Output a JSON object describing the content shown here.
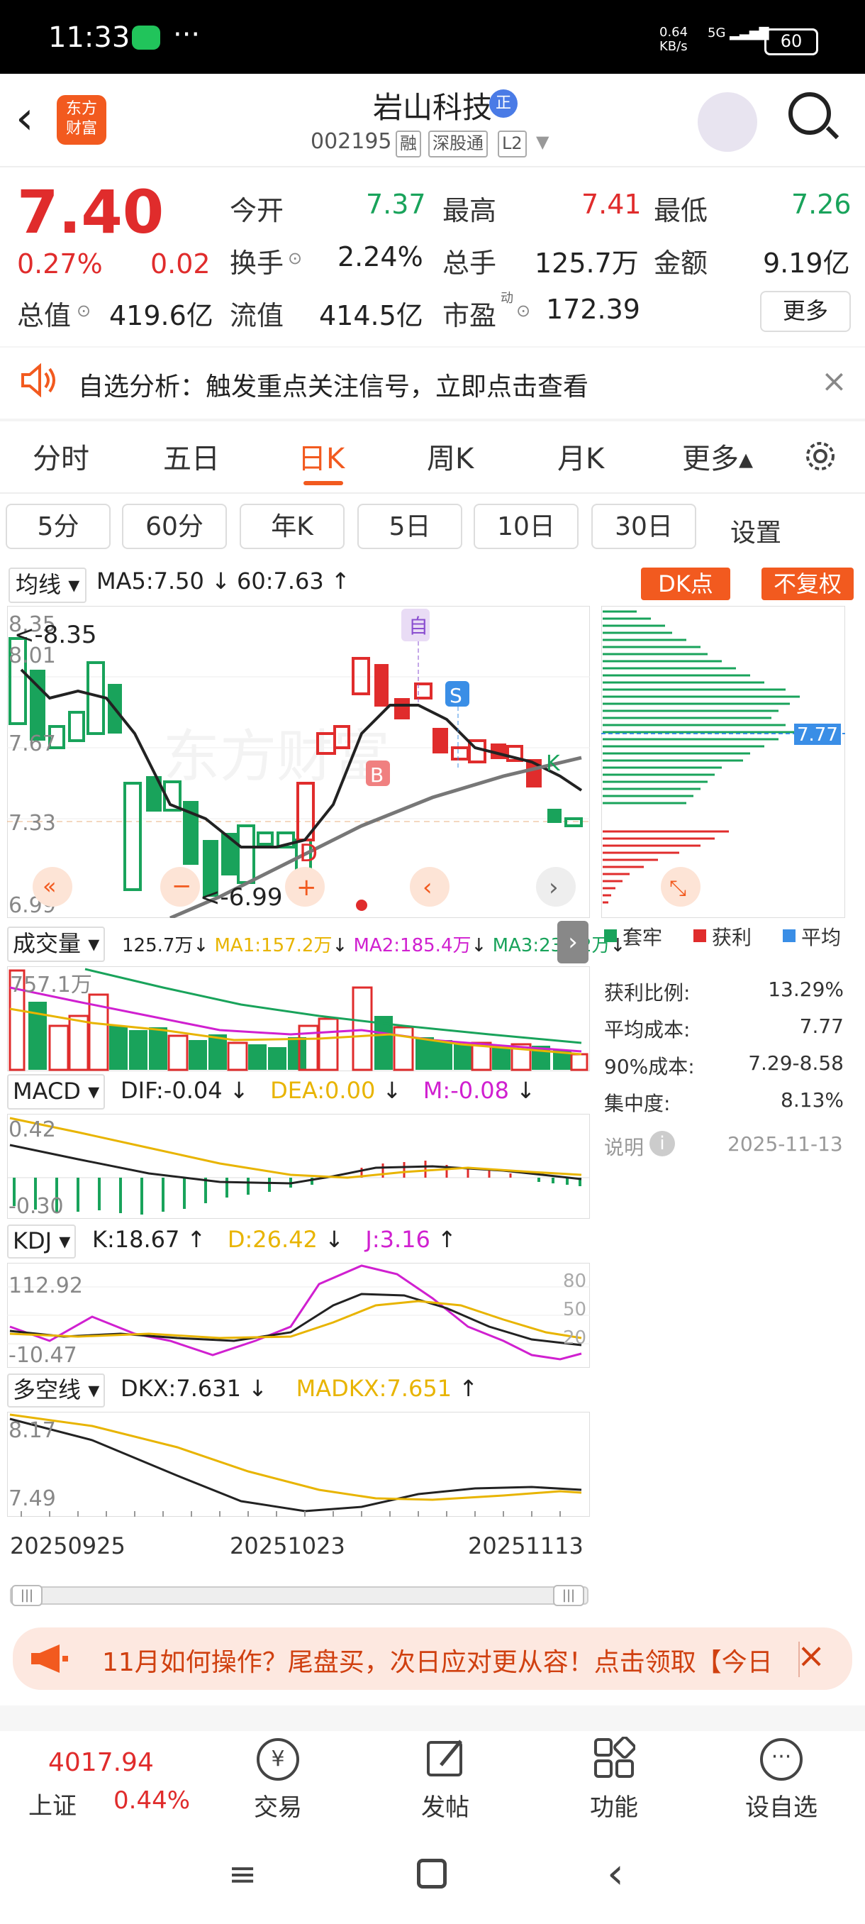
{
  "status_bar": {
    "time": "11:33",
    "net_speed": "0.64\nKB/s",
    "signal": "5G",
    "battery": "60",
    "more": "···"
  },
  "header": {
    "app_logo": "东方\n财富",
    "stock_name": "岩山科技",
    "stock_badge": "正",
    "stock_code": "002195",
    "tags": [
      "融",
      "深股通",
      "L2"
    ]
  },
  "quote": {
    "price": "7.40",
    "change_pct": "0.27%",
    "change": "0.02",
    "open_label": "今开",
    "open": "7.37",
    "high_label": "最高",
    "high": "7.41",
    "low_label": "最低",
    "low": "7.26",
    "turnover_label": "换手",
    "turnover": "2.24%",
    "volume_label": "总手",
    "volume": "125.7万",
    "amount_label": "金额",
    "amount": "9.19亿",
    "mktcap_label": "总值",
    "mktcap": "419.6亿",
    "float_label": "流值",
    "float": "414.5亿",
    "pe_label": "市盈",
    "pe_sup": "动",
    "pe": "172.39",
    "more_button": "更多"
  },
  "alert": {
    "text": "自选分析：触发重点关注信号，立即点击查看"
  },
  "tabs": [
    "分时",
    "五日",
    "日K",
    "周K",
    "月K",
    "更多▴"
  ],
  "active_tab": "日K",
  "periods": [
    "5分",
    "60分",
    "年K",
    "5日",
    "10日",
    "30日"
  ],
  "periods_setting": "设置",
  "ma_bar": {
    "selector": "均线",
    "ma5": "MA5:7.50",
    "ma60": "60:7.63",
    "dk_button": "DK点",
    "fq_button": "不复权"
  },
  "kline": {
    "y_labels": [
      "8.35",
      "8.01",
      "7.67",
      "7.33",
      "6.99"
    ],
    "high_marker": "<-8.35",
    "low_marker": "<-6.99",
    "markers": [
      "自",
      "S",
      "B",
      "D",
      "K"
    ],
    "watermark": "东方财富"
  },
  "chip": {
    "avg_label": "7.77",
    "legend": [
      "套牢",
      "获利",
      "平均"
    ],
    "stats": [
      {
        "label": "获利比例:",
        "value": "13.29%"
      },
      {
        "label": "平均成本:",
        "value": "7.77"
      },
      {
        "label": "90%成本:",
        "value": "7.29-8.58"
      },
      {
        "label": "集中度:",
        "value": "8.13%"
      }
    ],
    "note_label": "说明",
    "date": "2025-11-13"
  },
  "volume": {
    "selector": "成交量",
    "vol": "125.7万",
    "ma1": "MA1:157.2万",
    "ma2": "MA2:185.4万",
    "ma3": "MA3:239.2万",
    "y_label": "757.1万"
  },
  "macd": {
    "selector": "MACD",
    "dif": "DIF:-0.04",
    "dea": "DEA:0.00",
    "m": "M:-0.08",
    "y_top": "0.42",
    "y_bottom": "-0.30"
  },
  "kdj": {
    "selector": "KDJ",
    "k": "K:18.67",
    "d": "D:26.42",
    "j": "J:3.16",
    "y_top": "112.92",
    "y_bottom": "-10.47",
    "levels": [
      "80",
      "50",
      "20"
    ]
  },
  "dkx": {
    "selector": "多空线",
    "dkx": "DKX:7.631",
    "madkx": "MADKX:7.651",
    "y_top": "8.17",
    "y_bottom": "7.49"
  },
  "dates": [
    "20250925",
    "20251023",
    "20251113"
  ],
  "banner": {
    "text": "11月如何操作？尾盘买，次日应对更从容！点击领取【今日"
  },
  "bottom": {
    "index_value": "4017.94",
    "index_name": "上证",
    "index_change": "0.44%",
    "buttons": [
      "交易",
      "发帖",
      "功能",
      "设自选"
    ]
  },
  "colors": {
    "up": "#e02c2c",
    "down": "#19a35b",
    "accent": "#f25a1f",
    "yellow": "#e8b400",
    "magenta": "#d020d0",
    "blue": "#3a8ee6"
  }
}
